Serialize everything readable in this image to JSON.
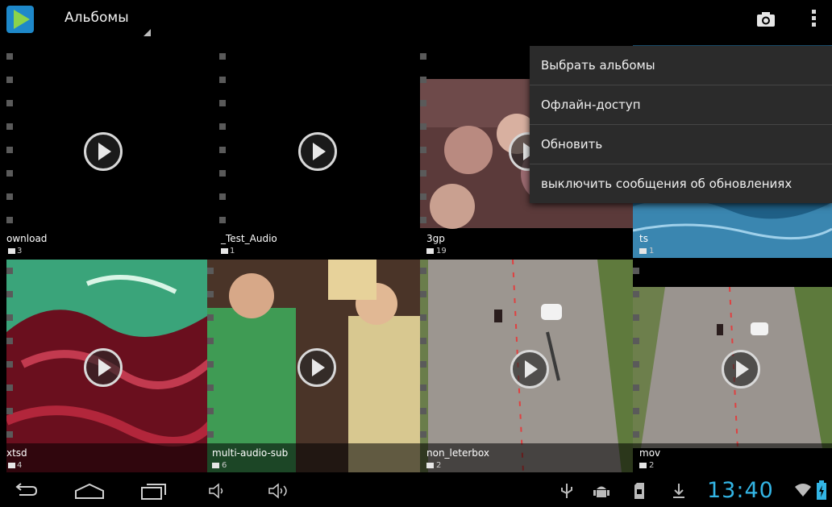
{
  "action_bar": {
    "title": "Альбомы",
    "icons": [
      "app-play-icon",
      "camera-icon",
      "overflow-menu-icon"
    ]
  },
  "overflow_menu": {
    "items": [
      "Выбрать альбомы",
      "Офлайн-доступ",
      "Обновить",
      "выключить  сообщения об обновлениях"
    ]
  },
  "albums": [
    {
      "name": "ownload",
      "count": "3"
    },
    {
      "name": "_Test_Audio",
      "count": "1"
    },
    {
      "name": "3gp",
      "count": "19"
    },
    {
      "name": "ts",
      "count": "1"
    },
    {
      "name": "xtsd",
      "count": "4"
    },
    {
      "name": "multi-audio-sub",
      "count": "6"
    },
    {
      "name": "non_leterbox",
      "count": "2"
    },
    {
      "name": "mov",
      "count": "2"
    }
  ],
  "status_bar": {
    "clock": "13:40",
    "icons": [
      "back-icon",
      "home-icon",
      "recent-apps-icon",
      "volume-down-icon",
      "volume-up-icon",
      "usb-icon",
      "android-debug-icon",
      "sd-card-icon",
      "download-icon",
      "wifi-icon",
      "battery-icon"
    ]
  },
  "colors": {
    "accent": "#33b5e5",
    "menu_bg": "#2b2b2b",
    "background": "#000000"
  }
}
